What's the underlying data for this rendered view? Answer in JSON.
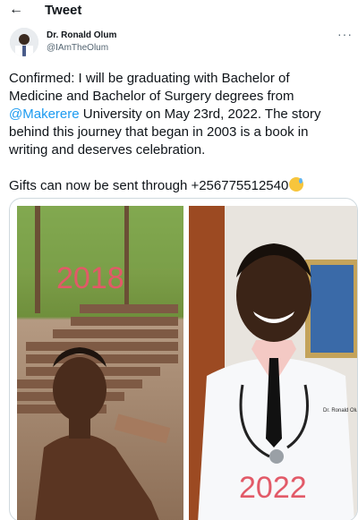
{
  "header": {
    "title": "Tweet",
    "back_icon": "arrow-left-icon"
  },
  "author": {
    "name": "Dr. Ronald Olum",
    "handle": "@IAmTheOlum"
  },
  "tweet": {
    "line1": "Confirmed: I will be graduating with Bachelor of",
    "line2": "Medicine and Bachelor of Surgery degrees from",
    "mention": "@Makerere",
    "line3_rest": " University on May 23rd, 2022. The story",
    "line4": "behind this journey that began in 2003 is a book in",
    "line5": "writing and deserves celebration.",
    "line6": "Gifts can now be sent through +256775512540",
    "emoji": "sweat-smile-emoji"
  },
  "media": {
    "left_year": "2018",
    "right_year": "2022",
    "coat_label": "Dr. Ronald Olum"
  },
  "colors": {
    "mention": "#1d9bf0",
    "year_text": "#e25a68",
    "muted": "#536471"
  }
}
